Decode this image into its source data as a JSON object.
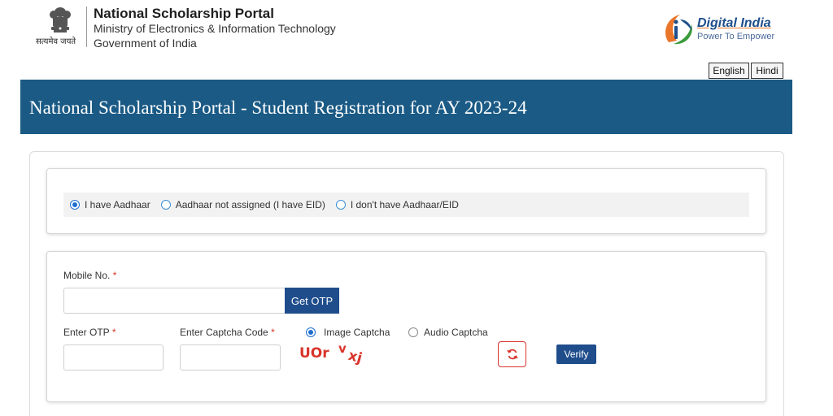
{
  "header": {
    "emblem_caption": "सत्यमेव जयते",
    "org_title": "National Scholarship Portal",
    "org_line1": "Ministry of Electronics & Information Technology",
    "org_line2": "Government of India",
    "digital_india_title": "Digital India",
    "digital_india_tagline": "Power To Empower",
    "lang_english": "English",
    "lang_hindi": "Hindi"
  },
  "banner": {
    "title": "National Scholarship Portal - Student Registration for AY 2023-24"
  },
  "aadhaar_options": [
    {
      "label": "I have Aadhaar",
      "selected": true
    },
    {
      "label": "Aadhaar not assigned (I have EID)",
      "selected": false
    },
    {
      "label": "I don't have Aadhaar/EID",
      "selected": false
    }
  ],
  "form": {
    "mobile_label": "Mobile No.",
    "required_mark": "*",
    "get_otp_label": "Get OTP",
    "otp_label": "Enter OTP",
    "captcha_code_label": "Enter Captcha Code",
    "image_captcha_label": "Image Captcha",
    "audio_captcha_label": "Audio Captcha",
    "captcha_mode": "image",
    "captcha_text": "UOr vxj",
    "verify_label": "Verify"
  },
  "colors": {
    "banner": "#1a5a85",
    "button": "#1f4d8c",
    "required": "#d9342b",
    "radio_accent": "#1e6fd0"
  }
}
